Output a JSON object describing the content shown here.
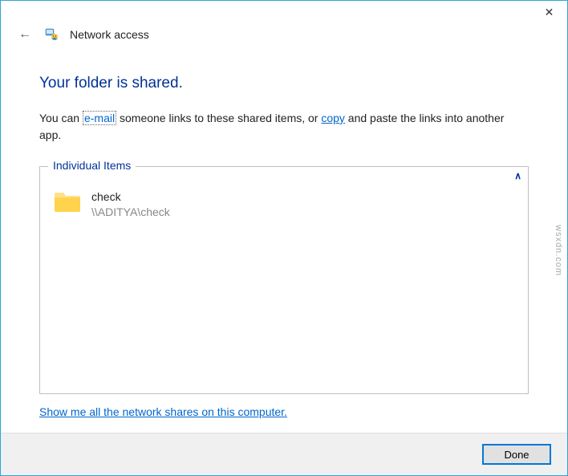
{
  "titlebar": {
    "close_symbol": "✕"
  },
  "header": {
    "back_symbol": "←",
    "title": "Network access"
  },
  "content": {
    "heading": "Your folder is shared.",
    "desc_part1": "You can ",
    "link_email": "e-mail",
    "desc_part2": " someone links to these shared items, or ",
    "link_copy": "copy",
    "desc_part3": " and paste the links into another app."
  },
  "items_box": {
    "legend": "Individual Items",
    "chevron": "⌃",
    "items": [
      {
        "name": "check",
        "path": "\\\\ADITYA\\check"
      }
    ]
  },
  "bottom_link": "Show me all the network shares on this computer.",
  "footer": {
    "done_label": "Done"
  },
  "watermark": "wsxdn.com"
}
